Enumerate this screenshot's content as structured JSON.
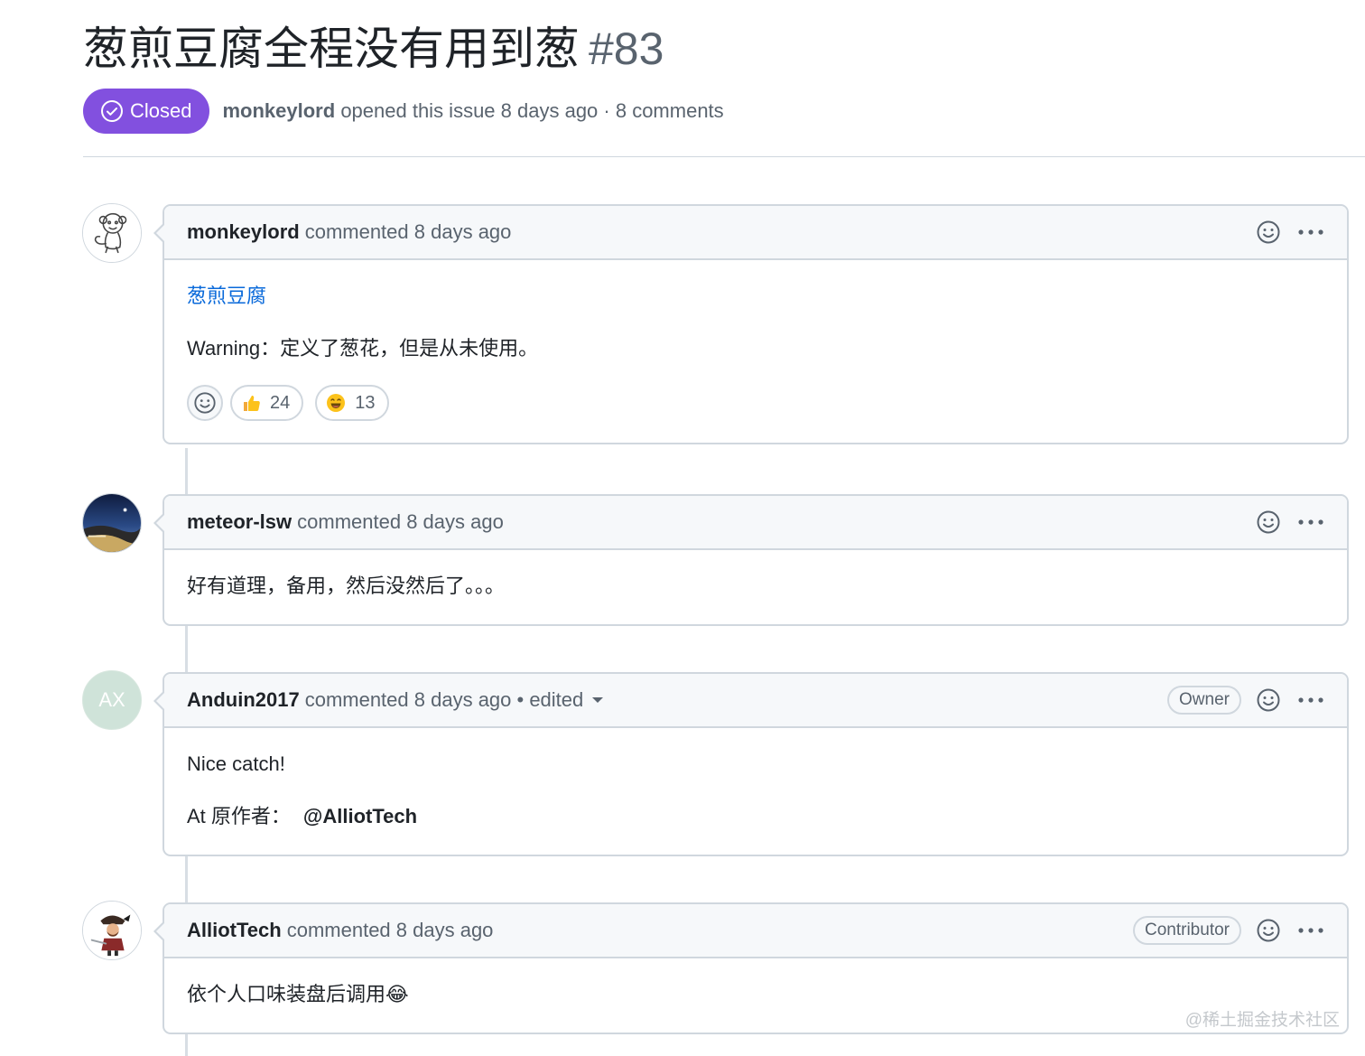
{
  "issue": {
    "title": "葱煎豆腐全程没有用到葱",
    "number": "#83",
    "state": "Closed",
    "author": "monkeylord",
    "meta": "opened this issue 8 days ago · 8 comments"
  },
  "colors": {
    "closed_badge": "#8250df",
    "link": "#0969da",
    "border": "#d0d7de",
    "header_bg": "#f6f8fa",
    "muted_text": "#59636e"
  },
  "comments": [
    {
      "author": "monkeylord",
      "meta": "commented 8 days ago",
      "avatar_icon": "monkey-sketch-avatar",
      "body_link": "葱煎豆腐",
      "body_text": "Warning：定义了葱花，但是从未使用。",
      "reactions": [
        {
          "icon": "thumbs-up-icon",
          "count": "24"
        },
        {
          "icon": "laugh-emoji-icon",
          "count": "13"
        }
      ]
    },
    {
      "author": "meteor-lsw",
      "meta": "commented 8 days ago",
      "avatar_icon": "night-landscape-avatar",
      "body_text": "好有道理，备用，然后没然后了。。。"
    },
    {
      "author": "Anduin2017",
      "meta": "commented 8 days ago • edited",
      "avatar_initials": "AX",
      "badge": "Owner",
      "body_text": "Nice catch!",
      "body_text_2": "At 原作者：",
      "mention": "@AlliotTech"
    },
    {
      "author": "AlliotTech",
      "meta": "commented 8 days ago",
      "avatar_icon": "pirate-character-avatar",
      "badge": "Contributor",
      "body_text": "依个人口味装盘后调用😂"
    }
  ],
  "watermark": "@稀土掘金技术社区"
}
